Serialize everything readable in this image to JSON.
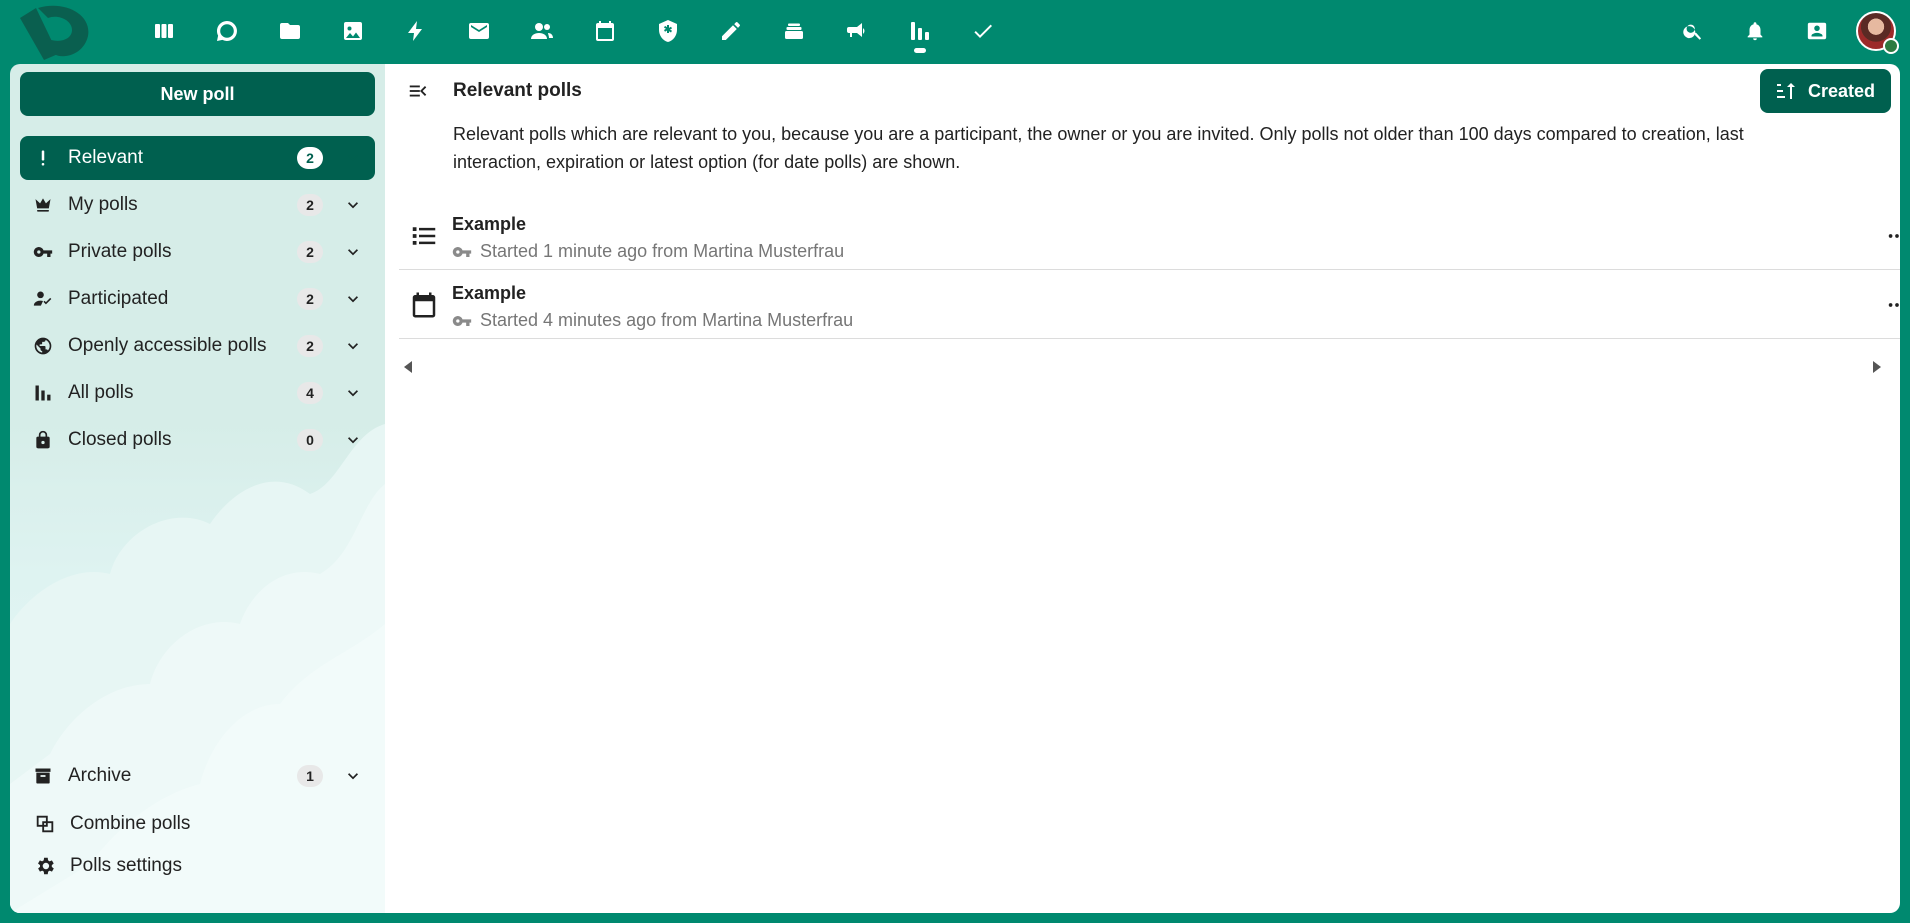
{
  "header": {
    "apps": [
      {
        "name": "dashboard-icon"
      },
      {
        "name": "talk-icon"
      },
      {
        "name": "files-icon"
      },
      {
        "name": "photos-icon"
      },
      {
        "name": "activity-icon"
      },
      {
        "name": "mail-icon"
      },
      {
        "name": "contacts-icon"
      },
      {
        "name": "calendar-icon"
      },
      {
        "name": "passwords-icon"
      },
      {
        "name": "notes-icon"
      },
      {
        "name": "deck-icon"
      },
      {
        "name": "announcements-icon"
      },
      {
        "name": "polls-icon",
        "active": true
      },
      {
        "name": "tasks-icon"
      }
    ],
    "right": [
      "search-icon",
      "notifications-icon",
      "contacts-menu-icon"
    ],
    "user_status": "online"
  },
  "sidebar": {
    "new_poll_label": "New poll",
    "items": [
      {
        "label": "Relevant",
        "count": "2",
        "icon": "exclamation-icon",
        "active": true
      },
      {
        "label": "My polls",
        "count": "2",
        "icon": "crown-icon"
      },
      {
        "label": "Private polls",
        "count": "2",
        "icon": "key-icon"
      },
      {
        "label": "Participated",
        "count": "2",
        "icon": "account-check-icon"
      },
      {
        "label": "Openly accessible polls",
        "count": "2",
        "icon": "earth-icon"
      },
      {
        "label": "All polls",
        "count": "4",
        "icon": "bar-chart-icon"
      },
      {
        "label": "Closed polls",
        "count": "0",
        "icon": "lock-icon"
      }
    ],
    "archive": {
      "label": "Archive",
      "count": "1",
      "icon": "archive-icon"
    },
    "combine_label": "Combine polls",
    "settings_label": "Polls settings"
  },
  "main": {
    "title": "Relevant polls",
    "sort_label": "Created",
    "description": "Relevant polls which are relevant to you, because you are a participant, the owner or you are invited. Only polls not older than 100 days compared to creation, last interaction, expiration or latest option (for date polls) are shown.",
    "polls": [
      {
        "title": "Example",
        "type": "text-poll-icon",
        "meta": "Started 1 minute ago from Martina Musterfrau"
      },
      {
        "title": "Example",
        "type": "date-poll-icon",
        "meta": "Started 4 minutes ago from Martina Musterfrau"
      }
    ]
  }
}
